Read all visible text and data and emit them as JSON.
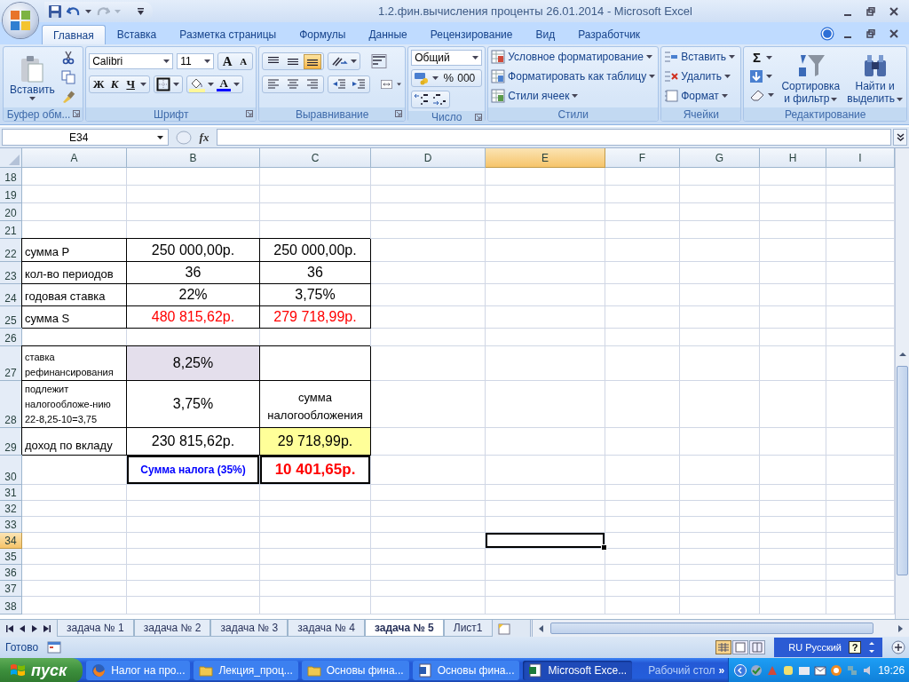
{
  "window": {
    "title": "1.2.фин.вычисления проценты 26.01.2014 - Microsoft Excel"
  },
  "ribbon": {
    "tabs": [
      {
        "label": "Главная",
        "selected": true
      },
      {
        "label": "Вставка",
        "selected": false
      },
      {
        "label": "Разметка страницы",
        "selected": false
      },
      {
        "label": "Формулы",
        "selected": false
      },
      {
        "label": "Данные",
        "selected": false
      },
      {
        "label": "Рецензирование",
        "selected": false
      },
      {
        "label": "Вид",
        "selected": false
      },
      {
        "label": "Разработчик",
        "selected": false
      }
    ],
    "clipboard": {
      "label": "Буфер обм...",
      "paste": "Вставить"
    },
    "font": {
      "label": "Шрифт",
      "family": "Calibri",
      "size": "11",
      "grow": "A",
      "shrink": "A",
      "bold": "Ж",
      "italic": "К",
      "underline": "Ч",
      "font_color": "A"
    },
    "alignment": {
      "label": "Выравнивание",
      "vertical": [
        {
          "selected": false
        },
        {
          "selected": false
        },
        {
          "selected": true
        }
      ]
    },
    "number": {
      "label": "Число",
      "format": "Общий",
      "percent": "%",
      "thousands": "000"
    },
    "styles": {
      "label": "Стили",
      "items": [
        "Условное форматирование",
        "Форматировать как таблицу",
        "Стили ячеек"
      ]
    },
    "cells": {
      "label": "Ячейки",
      "items": [
        "Вставить",
        "Удалить",
        "Формат"
      ]
    },
    "editing": {
      "label": "Редактирование",
      "sum": "Σ",
      "sort": [
        "Сортировка",
        "и фильтр"
      ],
      "find": [
        "Найти и",
        "выделить"
      ]
    }
  },
  "formula_bar": {
    "name_box": "E34",
    "function_button": "fx"
  },
  "sheet": {
    "columns": [
      {
        "label": "A",
        "selected": false
      },
      {
        "label": "B",
        "selected": false
      },
      {
        "label": "C",
        "selected": false
      },
      {
        "label": "D",
        "selected": false
      },
      {
        "label": "E",
        "selected": true
      },
      {
        "label": "F",
        "selected": false
      },
      {
        "label": "G",
        "selected": false
      },
      {
        "label": "H",
        "selected": false
      },
      {
        "label": "I",
        "selected": false
      }
    ],
    "rows": [
      {
        "number": "18",
        "selected": false,
        "boxed": false
      },
      {
        "number": "19",
        "selected": false,
        "boxed": false
      },
      {
        "number": "20",
        "selected": false,
        "boxed": false
      },
      {
        "number": "21",
        "selected": false,
        "boxed": false
      },
      {
        "number": "22",
        "selected": false,
        "boxed": true,
        "cells": [
          {
            "text": "сумма Р",
            "kind": "label"
          },
          {
            "text": "250 000,00р.",
            "kind": "value"
          },
          {
            "text": "250 000,00р.",
            "kind": "value"
          }
        ]
      },
      {
        "number": "23",
        "selected": false,
        "boxed": true,
        "cells": [
          {
            "text": "кол-во периодов",
            "kind": "label"
          },
          {
            "text": "36",
            "kind": "value"
          },
          {
            "text": "36",
            "kind": "value"
          }
        ]
      },
      {
        "number": "24",
        "selected": false,
        "boxed": true,
        "cells": [
          {
            "text": "годовая ставка",
            "kind": "label"
          },
          {
            "text": "22%",
            "kind": "value"
          },
          {
            "text": "3,75%",
            "kind": "value"
          }
        ]
      },
      {
        "number": "25",
        "selected": false,
        "boxed": true,
        "cells": [
          {
            "text": "сумма S",
            "kind": "label"
          },
          {
            "text": "480 815,62р.",
            "kind": "result"
          },
          {
            "text": "279 718,99р.",
            "kind": "result"
          }
        ]
      },
      {
        "number": "26",
        "selected": false,
        "boxed": false
      },
      {
        "number": "27",
        "selected": false,
        "boxed": true,
        "cells": [
          {
            "text": "ставка рефинансирования",
            "kind": "note"
          },
          {
            "text": "8,25%",
            "kind": "rate"
          }
        ]
      },
      {
        "number": "28",
        "selected": false,
        "boxed": true,
        "cells": [
          {
            "text": "подлежит налогообложе-нию 22-8,25-10=3,75",
            "kind": "note"
          },
          {
            "text": "3,75%",
            "kind": "value"
          },
          {
            "text": "сумма налогообложения",
            "kind": "heading"
          }
        ]
      },
      {
        "number": "29",
        "selected": false,
        "boxed": true,
        "cells": [
          {
            "text": "доход по вкладу",
            "kind": "label"
          },
          {
            "text": "230 815,62р.",
            "kind": "value"
          },
          {
            "text": "29 718,99р.",
            "kind": "taxable"
          }
        ]
      },
      {
        "number": "30",
        "selected": false,
        "boxed": false,
        "cells": [
          {
            "kind": "empty"
          },
          {
            "text": "Сумма налога (35%)",
            "kind": "caption"
          },
          {
            "text": "10 401,65р.",
            "kind": "total"
          }
        ]
      },
      {
        "number": "31",
        "selected": false,
        "boxed": false
      },
      {
        "number": "32",
        "selected": false,
        "boxed": false
      },
      {
        "number": "33",
        "selected": false,
        "boxed": false
      },
      {
        "number": "34",
        "selected": true,
        "boxed": false
      },
      {
        "number": "35",
        "selected": false,
        "boxed": false
      },
      {
        "number": "36",
        "selected": false,
        "boxed": false
      },
      {
        "number": "37",
        "selected": false,
        "boxed": false
      },
      {
        "number": "38",
        "selected": false,
        "boxed": false
      }
    ]
  },
  "sheet_tabs": [
    {
      "label": "задача № 1",
      "selected": false
    },
    {
      "label": "задача № 2",
      "selected": false
    },
    {
      "label": "задача № 3",
      "selected": false
    },
    {
      "label": "задача № 4",
      "selected": false
    },
    {
      "label": "задача № 5",
      "selected": true
    },
    {
      "label": "Лист1",
      "selected": false
    }
  ],
  "status_bar": {
    "text": "Готово",
    "language": "RU Русский",
    "help": "?"
  },
  "taskbar": {
    "start": "пуск",
    "items": [
      {
        "label": "Налог на про...",
        "kind": "browser",
        "selected": false
      },
      {
        "label": "Лекция_проц...",
        "kind": "folder",
        "selected": false
      },
      {
        "label": "Основы фина...",
        "kind": "folder",
        "selected": false
      },
      {
        "label": "Основы фина...",
        "kind": "document",
        "selected": false
      },
      {
        "label": "Microsoft Exce...",
        "kind": "spreadsheet",
        "selected": true
      }
    ],
    "desktop": "Рабочий стол",
    "more": "»",
    "time": "19:26"
  }
}
